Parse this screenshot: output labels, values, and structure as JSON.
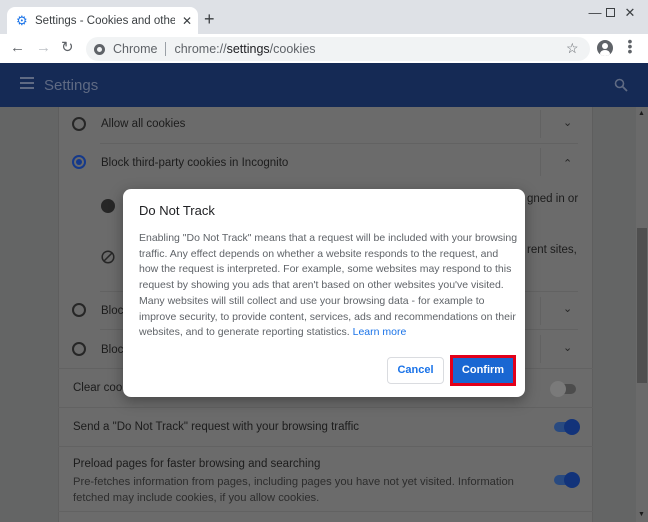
{
  "browser": {
    "tab_title": "Settings - Cookies and other site",
    "omnibox_chip": "Chrome",
    "url_prefix": "chrome://",
    "url_host": "settings",
    "url_path": "/cookies",
    "icons": {
      "tab": "gear-icon",
      "new_tab": "plus-icon",
      "minimize": "minimize-icon",
      "maximize": "maximize-icon",
      "close": "close-icon",
      "back": "arrow-left-icon",
      "forward": "arrow-right-icon",
      "reload": "reload-icon",
      "bookmark": "star-icon",
      "profile": "avatar-icon",
      "menu": "kebab-icon"
    }
  },
  "header": {
    "title": "Settings"
  },
  "settings": {
    "cookie_options": [
      {
        "label": "Allow all cookies",
        "selected": false,
        "expanded": false
      },
      {
        "label": "Block third-party cookies in Incognito",
        "selected": true,
        "expanded": true
      },
      {
        "label": "Block",
        "selected": false,
        "expanded": false
      },
      {
        "label": "Block",
        "selected": false,
        "expanded": false
      }
    ],
    "expanded_details": [
      {
        "icon": "cookie-icon",
        "text_fragment": "gned in or"
      },
      {
        "icon": "block-icon",
        "text_fragment": "rent sites,"
      }
    ],
    "toggles": [
      {
        "label": "Clear cooki",
        "on": false
      },
      {
        "label": "Send a \"Do Not Track\" request with your browsing traffic",
        "on": true
      },
      {
        "label": "Preload pages for faster browsing and searching",
        "description": "Pre-fetches information from pages, including pages you have not yet visited. Information fetched may include cookies, if you allow cookies.",
        "on": true
      }
    ]
  },
  "dialog": {
    "title": "Do Not Track",
    "body": "Enabling \"Do Not Track\" means that a request will be included with your browsing traffic. Any effect depends on whether a website responds to the request, and how the request is interpreted. For example, some websites may respond to this request by showing you ads that aren't based on other websites you've visited. Many websites will still collect and use your browsing data - for example to improve security, to provide content, services, ads and recommendations on their websites, and to generate reporting statistics.",
    "link": "Learn more",
    "cancel": "Cancel",
    "confirm": "Confirm",
    "highlight_color": "#e2001a",
    "accent_color": "#1a73e8"
  }
}
